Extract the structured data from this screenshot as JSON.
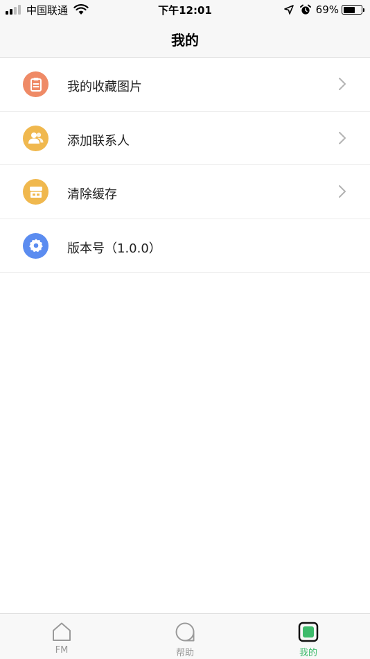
{
  "status_bar": {
    "carrier": "中国联通",
    "time": "下午12:01",
    "battery_percent_text": "69%",
    "battery_level": 0.69,
    "signal_bars_filled": 2,
    "signal_bars_total": 4
  },
  "nav": {
    "title": "我的"
  },
  "menu": {
    "items": [
      {
        "label": "我的收藏图片",
        "icon": "clipboard-icon",
        "color": "#ef8a66",
        "has_chevron": true
      },
      {
        "label": "添加联系人",
        "icon": "contacts-icon",
        "color": "#f0b84e",
        "has_chevron": true
      },
      {
        "label": "清除缓存",
        "icon": "storage-icon",
        "color": "#f0b84e",
        "has_chevron": true
      },
      {
        "label": "版本号（1.0.0）",
        "icon": "settings-gear-icon",
        "color": "#5b8cf0",
        "has_chevron": false
      }
    ]
  },
  "tabbar": {
    "tabs": [
      {
        "label": "FM",
        "icon": "home-icon",
        "active": false
      },
      {
        "label": "帮助",
        "icon": "help-bubble-icon",
        "active": false
      },
      {
        "label": "我的",
        "icon": "profile-square-icon",
        "active": true
      }
    ],
    "active_color": "#3dbb6b",
    "inactive_color": "#999999"
  }
}
